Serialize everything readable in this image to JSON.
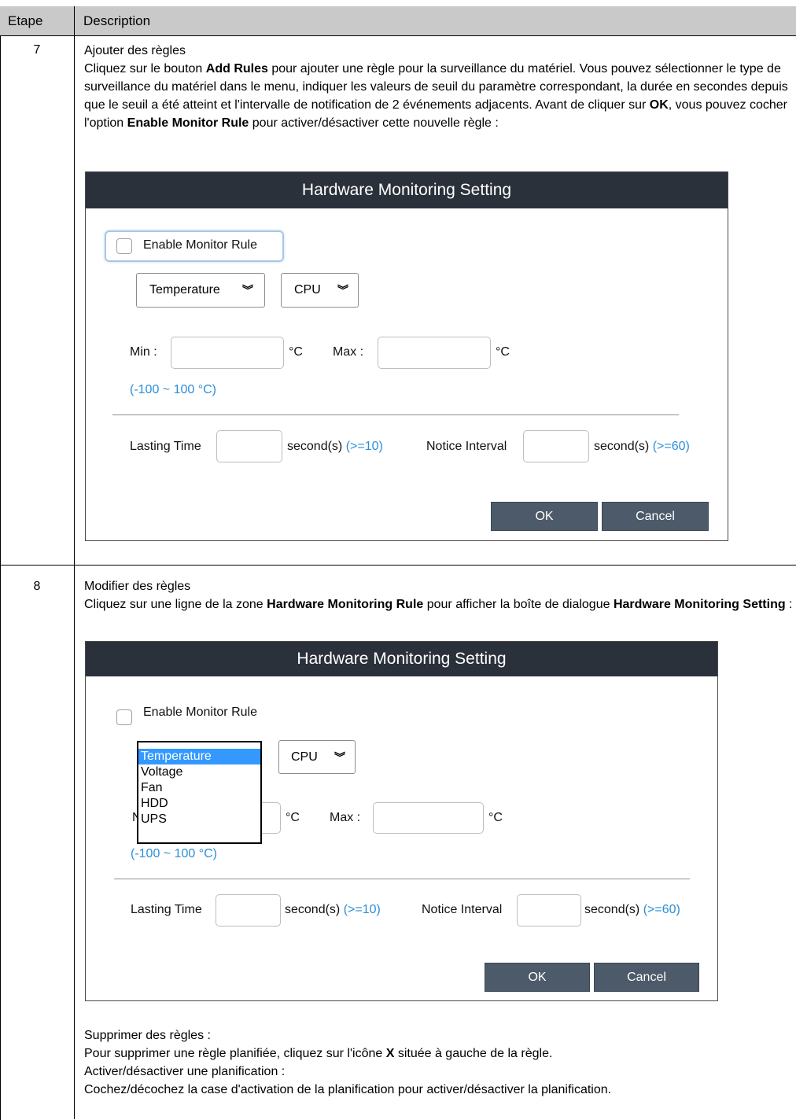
{
  "table": {
    "header": {
      "col1": "Etape",
      "col2": "Description"
    }
  },
  "row7": {
    "step": "7",
    "title": "Ajouter des règles",
    "p1_a": "Cliquez sur le bouton ",
    "p1_b": "Add Rules",
    "p1_c": " pour ajouter une règle pour la surveillance du matériel. Vous pouvez sélectionner le type de surveillance du matériel dans le menu, indiquer les valeurs de seuil du paramètre correspondant, la durée en secondes depuis que le seuil a été atteint et l'intervalle de notification de 2 événements adjacents. Avant de cliquer sur ",
    "p1_d": "OK",
    "p1_e": ", vous pouvez cocher l'option ",
    "p1_f": "Enable Monitor Rule",
    "p1_g": " pour activer/désactiver cette nouvelle règle :",
    "dialog": {
      "title": "Hardware Monitoring Setting",
      "enable_label": "Enable Monitor Rule",
      "type_select": "Temperature",
      "target_select": "CPU",
      "min_label": "Min :",
      "max_label": "Max :",
      "unit": "°C",
      "range_hint": "(-100 ~ 100 °C)",
      "lasting_label": "Lasting Time",
      "lasting_unit": "second(s)",
      "lasting_hint": "(>=10)",
      "notice_label": "Notice Interval",
      "notice_unit": "second(s)",
      "notice_hint": "(>=60)",
      "ok": "OK",
      "cancel": "Cancel"
    }
  },
  "row8": {
    "step": "8",
    "title": "Modifier des règles",
    "p1_a": "Cliquez sur une ligne de la zone ",
    "p1_b": "Hardware Monitoring Rule",
    "p1_c": " pour afficher la boîte de dialogue ",
    "p1_d": "Hardware Monitoring Setting",
    "p1_e": " :",
    "dialog": {
      "title": "Hardware Monitoring Setting",
      "enable_label": "Enable Monitor Rule",
      "dropdown_items": [
        "Temperature",
        "Voltage",
        "Fan",
        "HDD",
        "UPS"
      ],
      "target_select": "CPU",
      "min_label_partial": "N",
      "max_label": "Max :",
      "unit": "°C",
      "range_hint": "(-100 ~ 100 °C)",
      "lasting_label": "Lasting Time",
      "lasting_unit": "second(s)",
      "lasting_hint": "(>=10)",
      "notice_label": "Notice Interval",
      "notice_unit": "second(s)",
      "notice_hint": "(>=60)",
      "ok": "OK",
      "cancel": "Cancel"
    },
    "delete_title": "Supprimer des règles :",
    "delete_a": "Pour supprimer une règle planifiée, cliquez sur l'icône ",
    "delete_b": "X",
    "delete_c": " située à gauche de la règle.",
    "toggle_title": "Activer/désactiver une planification :",
    "toggle_text": "Cochez/décochez la case d'activation de la planification pour activer/désactiver la planification."
  }
}
